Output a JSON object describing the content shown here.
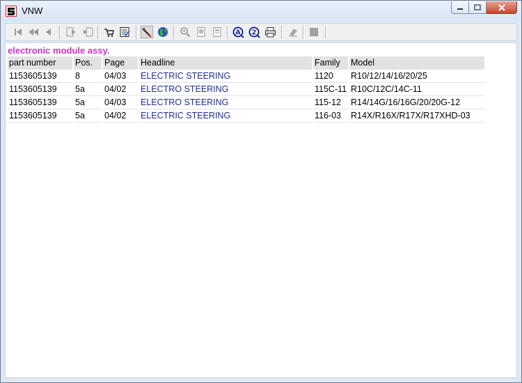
{
  "window": {
    "title": "VNW"
  },
  "heading": "electronic module assy.",
  "table": {
    "columns": [
      "part number",
      "Pos.",
      "Page",
      "Headline",
      "Family",
      "Model"
    ],
    "rows": [
      [
        "1153605139",
        "8",
        "04/03",
        "ELECTRIC STEERING",
        "1120",
        "R10/12/14/16/20/25"
      ],
      [
        "1153605139",
        "5a",
        "04/02",
        "ELECTRO STEERING",
        "115C-11",
        "R10C/12C/14C-11"
      ],
      [
        "1153605139",
        "5a",
        "04/03",
        "ELECTRO STEERING",
        "115-12",
        "R14/14G/16/16G/20/20G-12"
      ],
      [
        "1153605139",
        "5a",
        "04/02",
        "ELECTRIC STEERING",
        "116-03",
        "R14X/R16X/R17X/R17XHD-03"
      ]
    ]
  },
  "colors": {
    "heading": "#cc33cc",
    "headline_text": "#1f2b9c",
    "header_bg": "#e2e2e2"
  },
  "toolbar_icons": [
    "first-page-icon",
    "previous-page-icon",
    "previous-icon",
    "next-icon",
    "last-icon",
    "cart-icon",
    "checklist-icon",
    "tool-icon",
    "globe-icon",
    "zoom-icon",
    "page-icon",
    "page-alt-icon",
    "search-a-icon",
    "search-2-icon",
    "print-icon",
    "eraser-icon",
    "stop-icon"
  ]
}
